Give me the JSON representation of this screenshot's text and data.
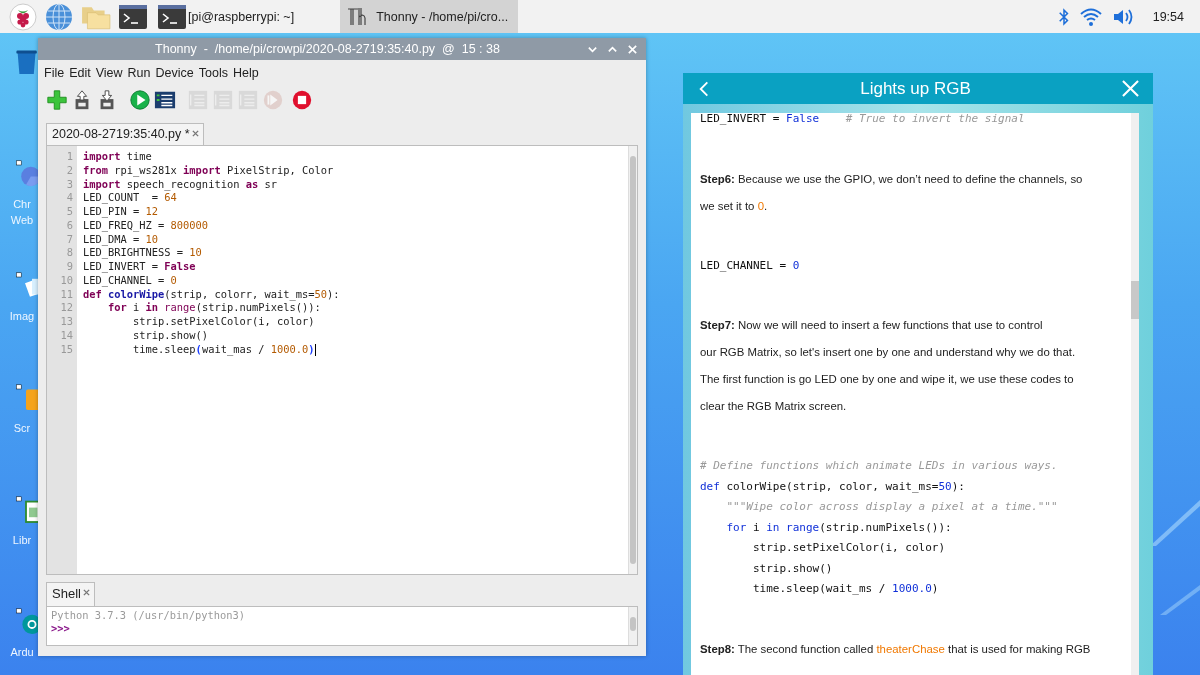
{
  "taskbar": {
    "launchers": [
      {
        "kind": "raspberry"
      },
      {
        "kind": "globe"
      },
      {
        "kind": "folder"
      },
      {
        "kind": "terminal"
      }
    ],
    "tasks": [
      {
        "kind": "terminal",
        "label": "[pi@raspberrypi: ~]",
        "selected": false
      },
      {
        "kind": "thonny",
        "label": "Thonny  -  /home/pi/cro...",
        "selected": true
      }
    ],
    "tray": {
      "clock": "19:54"
    }
  },
  "desktop_icons": [
    {
      "kind": "trash"
    },
    {
      "kind": "browser",
      "lines": [
        "Chr",
        "Web"
      ]
    },
    {
      "kind": "images",
      "lines": [
        "Imag"
      ]
    },
    {
      "kind": "scratch",
      "lines": [
        "Scr"
      ]
    },
    {
      "kind": "office",
      "lines": [
        "Libr"
      ]
    },
    {
      "kind": "arduino",
      "lines": [
        "Ardu"
      ]
    }
  ],
  "thonny": {
    "title": "Thonny  -  /home/pi/crowpi/2020-08-2719:35:40.py  @  15 : 38",
    "menu": [
      "File",
      "Edit",
      "View",
      "Run",
      "Device",
      "Tools",
      "Help"
    ],
    "toolbar": [
      {
        "kind": "new",
        "disabled": false
      },
      {
        "kind": "open",
        "disabled": false
      },
      {
        "kind": "save",
        "disabled": false
      },
      {
        "kind": "run",
        "disabled": false
      },
      {
        "kind": "debug",
        "disabled": false
      },
      {
        "kind": "step-over",
        "disabled": true
      },
      {
        "kind": "step-into",
        "disabled": true
      },
      {
        "kind": "step-out",
        "disabled": true
      },
      {
        "kind": "resume",
        "disabled": true
      },
      {
        "kind": "stop",
        "disabled": false
      }
    ],
    "editor_tab": "2020-08-2719:35:40.py *",
    "lines": [
      {
        "n": "1",
        "cursor": false,
        "tokens": [
          {
            "text": "import",
            "kind": "kw"
          },
          {
            "text": " time",
            "kind": "plain"
          }
        ]
      },
      {
        "n": "2",
        "cursor": false,
        "tokens": [
          {
            "text": "from",
            "kind": "kw"
          },
          {
            "text": " rpi_ws281x ",
            "kind": "plain"
          },
          {
            "text": "import",
            "kind": "kw"
          },
          {
            "text": " PixelStrip, Color",
            "kind": "plain"
          }
        ]
      },
      {
        "n": "3",
        "cursor": false,
        "tokens": [
          {
            "text": "import",
            "kind": "kw"
          },
          {
            "text": " speech_recognition ",
            "kind": "plain"
          },
          {
            "text": "as",
            "kind": "kw"
          },
          {
            "text": " sr",
            "kind": "plain"
          }
        ]
      },
      {
        "n": "4",
        "cursor": false,
        "tokens": [
          {
            "text": "LED_COUNT  = ",
            "kind": "plain"
          },
          {
            "text": "64",
            "kind": "num"
          }
        ]
      },
      {
        "n": "5",
        "cursor": false,
        "tokens": [
          {
            "text": "LED_PIN = ",
            "kind": "plain"
          },
          {
            "text": "12",
            "kind": "num"
          }
        ]
      },
      {
        "n": "6",
        "cursor": false,
        "tokens": [
          {
            "text": "LED_FREQ_HZ = ",
            "kind": "plain"
          },
          {
            "text": "800000",
            "kind": "num"
          }
        ]
      },
      {
        "n": "7",
        "cursor": false,
        "tokens": [
          {
            "text": "LED_DMA = ",
            "kind": "plain"
          },
          {
            "text": "10",
            "kind": "num"
          }
        ]
      },
      {
        "n": "8",
        "cursor": false,
        "tokens": [
          {
            "text": "LED_BRIGHTNESS = ",
            "kind": "plain"
          },
          {
            "text": "10",
            "kind": "num"
          }
        ]
      },
      {
        "n": "9",
        "cursor": false,
        "tokens": [
          {
            "text": "LED_INVERT = ",
            "kind": "plain"
          },
          {
            "text": "False",
            "kind": "kw"
          }
        ]
      },
      {
        "n": "10",
        "cursor": false,
        "tokens": [
          {
            "text": "LED_CHANNEL = ",
            "kind": "plain"
          },
          {
            "text": "0",
            "kind": "num"
          }
        ]
      },
      {
        "n": "11",
        "cursor": false,
        "tokens": [
          {
            "text": "def ",
            "kind": "kw"
          },
          {
            "text": "colorWipe",
            "kind": "def"
          },
          {
            "text": "(strip, colorr, wait_ms=",
            "kind": "plain"
          },
          {
            "text": "50",
            "kind": "num"
          },
          {
            "text": "):",
            "kind": "plain"
          }
        ]
      },
      {
        "n": "12",
        "cursor": false,
        "tokens": [
          {
            "text": "    for",
            "kind": "kw"
          },
          {
            "text": " i ",
            "kind": "plain"
          },
          {
            "text": "in",
            "kind": "kw"
          },
          {
            "text": " range",
            "kind": "builtin"
          },
          {
            "text": "(strip.numPixels()):",
            "kind": "plain"
          }
        ]
      },
      {
        "n": "13",
        "cursor": false,
        "tokens": [
          {
            "text": "        strip.setPixelColor(i, color)",
            "kind": "plain"
          }
        ]
      },
      {
        "n": "14",
        "cursor": false,
        "tokens": [
          {
            "text": "        strip.show()",
            "kind": "plain"
          }
        ]
      },
      {
        "n": "15",
        "cursor": true,
        "tokens": [
          {
            "text": "        time.sleep",
            "kind": "plain"
          },
          {
            "text": "(",
            "kind": "match"
          },
          {
            "text": "wait_mas / ",
            "kind": "plain"
          },
          {
            "text": "1000.0",
            "kind": "num"
          },
          {
            "text": ")",
            "kind": "match"
          }
        ]
      }
    ],
    "shell_tab": "Shell",
    "shell_output": "Python 3.7.3 (/usr/bin/python3)",
    "shell_prompt": ">>>"
  },
  "tutorial": {
    "title": "Lights up RGB",
    "blocks": [
      {
        "kind": "code",
        "lines": [
          [
            {
              "text": "LED_INVERT = ",
              "kind": "plain"
            },
            {
              "text": "False",
              "kind": "kw"
            },
            {
              "text": "    # True to invert the signal",
              "kind": "comment"
            }
          ]
        ]
      },
      {
        "kind": "para",
        "parts": [
          {
            "text": "Step6:",
            "kind": "bold"
          },
          {
            "text": " Because we use the GPIO, we don’t need to define the channels, so\nwe set it to ",
            "kind": "plain"
          },
          {
            "text": "0",
            "kind": "hl"
          },
          {
            "text": ".",
            "kind": "plain"
          }
        ]
      },
      {
        "kind": "code",
        "lines": [
          [
            {
              "text": "LED_CHANNEL = ",
              "kind": "plain"
            },
            {
              "text": "0",
              "kind": "num"
            }
          ]
        ]
      },
      {
        "kind": "para",
        "parts": [
          {
            "text": "Step7:",
            "kind": "bold"
          },
          {
            "text": " Now we will need to insert a few functions that use to control\nour RGB Matrix, so let's insert one by one and understand why we do that.\nThe first function is go LED one by one and wipe it, we use these codes to\nclear the RGB Matrix screen.",
            "kind": "plain"
          }
        ]
      },
      {
        "kind": "code",
        "lines": [
          [
            {
              "text": "# Define functions which animate LEDs in various ways.",
              "kind": "comment"
            }
          ],
          [
            {
              "text": "def",
              "kind": "kw"
            },
            {
              "text": " colorWipe(strip, color, wait_ms=",
              "kind": "plain"
            },
            {
              "text": "50",
              "kind": "num"
            },
            {
              "text": "):",
              "kind": "plain"
            }
          ],
          [
            {
              "text": "    \"\"\"Wipe color across display a pixel at a time.\"\"\"",
              "kind": "comment"
            }
          ],
          [
            {
              "text": "    for",
              "kind": "kw"
            },
            {
              "text": " i ",
              "kind": "plain"
            },
            {
              "text": "in range",
              "kind": "kw"
            },
            {
              "text": "(strip.numPixels()):",
              "kind": "plain"
            }
          ],
          [
            {
              "text": "        strip.setPixelColor(i, color)",
              "kind": "plain"
            }
          ],
          [
            {
              "text": "        strip.show()",
              "kind": "plain"
            }
          ],
          [
            {
              "text": "        time.sleep(wait_ms / ",
              "kind": "plain"
            },
            {
              "text": "1000.0",
              "kind": "num"
            },
            {
              "text": ")",
              "kind": "plain"
            }
          ]
        ]
      },
      {
        "kind": "para",
        "parts": [
          {
            "text": "Step8:",
            "kind": "bold"
          },
          {
            "text": " The second function called ",
            "kind": "plain"
          },
          {
            "text": "theaterChase",
            "kind": "hl"
          },
          {
            "text": " that is used for making RGB",
            "kind": "plain"
          }
        ]
      }
    ]
  }
}
